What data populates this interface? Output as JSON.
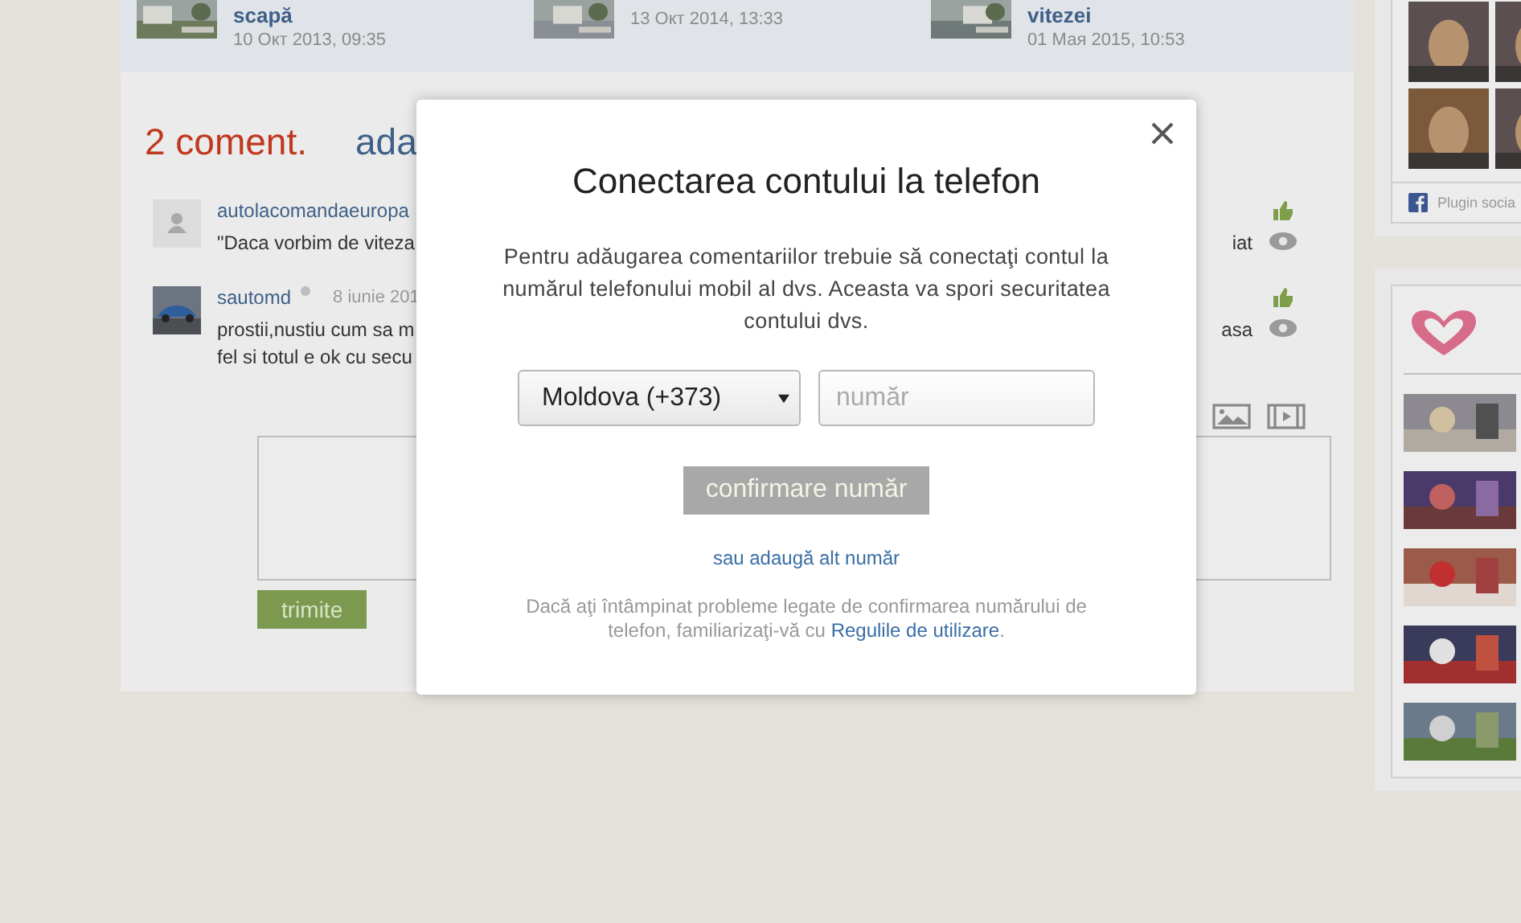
{
  "news": [
    {
      "title": "scapă",
      "date": "10 Окт 2013, 09:35",
      "thumb": {
        "kind": "picture"
      }
    },
    {
      "date": "13 Окт 2014, 13:33",
      "thumb": {
        "kind": "picture"
      }
    },
    {
      "title": "vitezei",
      "date": "01 Мая 2015, 10:53",
      "thumb": {
        "kind": "picture"
      }
    }
  ],
  "comments_header": {
    "count": "2 coment.",
    "add_link": "ada"
  },
  "comments": [
    {
      "avatar": {
        "kind": "icon"
      },
      "author": "autolacomandaeuropa",
      "lines": [
        {
          "left": "\"Daca vorbim de viteza",
          "right": "iat"
        }
      ]
    },
    {
      "avatar": {
        "kind": "picture"
      },
      "author": "sautomd",
      "online": false,
      "date": "8 iunie 201",
      "lines": [
        {
          "left": "prostii,nustiu cum sa m",
          "right": "asa"
        },
        {
          "left": "fel si totul e ok cu secu"
        }
      ]
    }
  ],
  "submit_button": "trimite",
  "sidebar": {
    "plugin_label": "Plugin socia",
    "photos": [
      {
        "kind": "picture"
      },
      {
        "kind": "picture"
      },
      {
        "kind": "picture"
      },
      {
        "kind": "picture"
      },
      {
        "kind": "picture"
      }
    ]
  },
  "modal": {
    "title": "Conectarea contului la telefon",
    "description": "Pentru adăugarea comentariilor trebuie să conectaţi contul la numărul telefonului mobil al dvs. Aceasta va spori securitatea contului dvs.",
    "country": "Moldova (+373)",
    "number_placeholder": "număr",
    "confirm_button": "confirmare număr",
    "alt_link": "sau adaugă alt număr",
    "note": "Dacă aţi întâmpinat probleme legate de confirmarea numărului de telefon, familiarizaţi-vă cu ",
    "note_link": "Regulile de utilizare",
    "note_end": "."
  }
}
